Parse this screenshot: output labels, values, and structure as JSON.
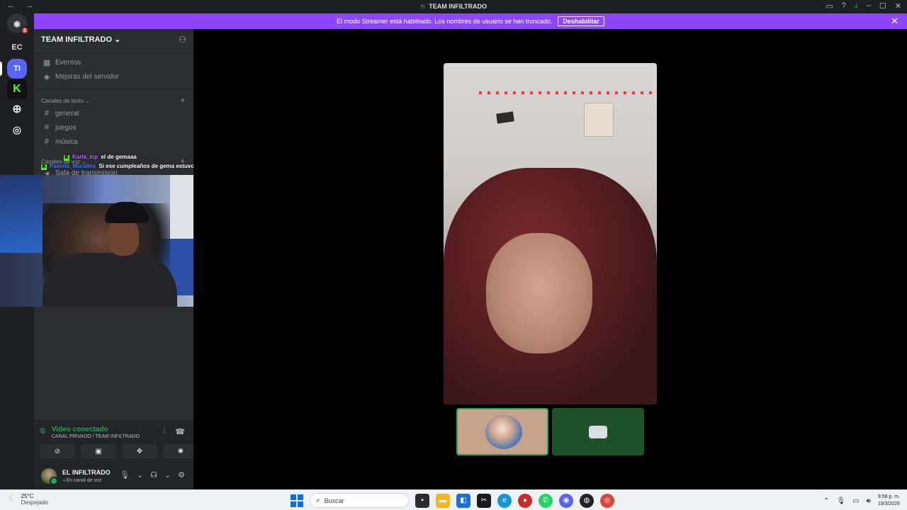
{
  "window": {
    "title_icon": "TI",
    "title": "TEAM INFILTRADO",
    "nav_back": "←",
    "nav_forward": "→"
  },
  "banner": {
    "text": "El modo Streamer está habilitado. Los nombres de usuario se han truncado.",
    "button": "Deshabilitar",
    "close": "✕"
  },
  "guilds": {
    "home_badge": "1",
    "ec": "EC",
    "ti": "TI"
  },
  "sidebar": {
    "server_name": "TEAM INFILTRADO",
    "items": [
      {
        "icon": "calendar-icon",
        "label": "Eventos"
      },
      {
        "icon": "boost-icon",
        "label": "Mejoras del servidor"
      }
    ],
    "text_category": "Canales de texto",
    "text_channels": [
      "general",
      "juegos",
      "música"
    ],
    "voice_category": "Canales de voz",
    "voice_channel": "Sala de transmisión"
  },
  "chat_overlay": [
    {
      "user": "Karla_icp",
      "message": "el de gemaaa"
    },
    {
      "user": "Pamela_Muralles",
      "message": "Si ese cumpleaños de gema estuvo bueno"
    }
  ],
  "voice": {
    "status": "Video conectado",
    "channel": "CANAL PRIVADO / TEAM INFILTRADO"
  },
  "user": {
    "name": "EL INFILTRADO",
    "status": "En canal de voz"
  },
  "taskbar": {
    "temp": "25°C",
    "weather": "Despejado",
    "search_placeholder": "Buscar",
    "time": "9:58 p. m.",
    "date": "19/3/2026"
  },
  "colors": {
    "banner": "#8f44fd",
    "connected": "#23a55a",
    "blurple": "#5865f2",
    "kick_green": "#53fc18"
  }
}
